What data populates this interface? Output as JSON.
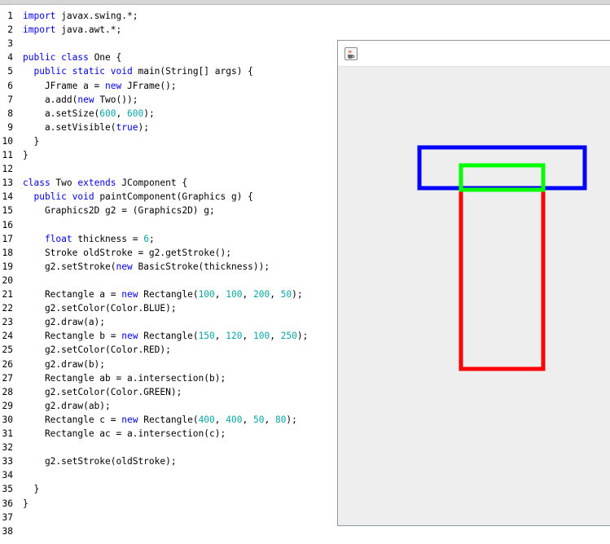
{
  "code_lines": [
    {
      "n": "1",
      "tokens": [
        {
          "t": "import",
          "c": "kw"
        },
        {
          "t": " javax.swing.*;"
        }
      ]
    },
    {
      "n": "2",
      "tokens": [
        {
          "t": "import",
          "c": "kw"
        },
        {
          "t": " java.awt.*;"
        }
      ]
    },
    {
      "n": "3",
      "tokens": []
    },
    {
      "n": "4",
      "tokens": [
        {
          "t": "public class",
          "c": "kw"
        },
        {
          "t": " One {"
        }
      ]
    },
    {
      "n": "5",
      "tokens": [
        {
          "t": "  "
        },
        {
          "t": "public static void",
          "c": "kw"
        },
        {
          "t": " main(String[] args) {"
        }
      ]
    },
    {
      "n": "6",
      "tokens": [
        {
          "t": "    JFrame a = "
        },
        {
          "t": "new",
          "c": "kw"
        },
        {
          "t": " JFrame();"
        }
      ]
    },
    {
      "n": "7",
      "tokens": [
        {
          "t": "    a.add("
        },
        {
          "t": "new",
          "c": "kw"
        },
        {
          "t": " Two());"
        }
      ]
    },
    {
      "n": "8",
      "tokens": [
        {
          "t": "    a.setSize("
        },
        {
          "t": "600",
          "c": "num"
        },
        {
          "t": ", "
        },
        {
          "t": "600",
          "c": "num"
        },
        {
          "t": ");"
        }
      ]
    },
    {
      "n": "9",
      "tokens": [
        {
          "t": "    a.setVisible("
        },
        {
          "t": "true",
          "c": "kw"
        },
        {
          "t": ");"
        }
      ]
    },
    {
      "n": "10",
      "tokens": [
        {
          "t": "  }"
        }
      ]
    },
    {
      "n": "11",
      "tokens": [
        {
          "t": "}"
        }
      ]
    },
    {
      "n": "12",
      "tokens": []
    },
    {
      "n": "13",
      "tokens": [
        {
          "t": "class",
          "c": "kw"
        },
        {
          "t": " Two "
        },
        {
          "t": "extends",
          "c": "kw"
        },
        {
          "t": " JComponent {"
        }
      ]
    },
    {
      "n": "14",
      "tokens": [
        {
          "t": "  "
        },
        {
          "t": "public void",
          "c": "kw"
        },
        {
          "t": " paintComponent(Graphics g) {"
        }
      ]
    },
    {
      "n": "15",
      "tokens": [
        {
          "t": "    Graphics2D g2 = (Graphics2D) g;"
        }
      ]
    },
    {
      "n": "16",
      "tokens": []
    },
    {
      "n": "17",
      "tokens": [
        {
          "t": "    "
        },
        {
          "t": "float",
          "c": "kw"
        },
        {
          "t": " thickness = "
        },
        {
          "t": "6",
          "c": "num"
        },
        {
          "t": ";"
        }
      ]
    },
    {
      "n": "18",
      "tokens": [
        {
          "t": "    Stroke oldStroke = g2.getStroke();"
        }
      ]
    },
    {
      "n": "19",
      "tokens": [
        {
          "t": "    g2.setStroke("
        },
        {
          "t": "new",
          "c": "kw"
        },
        {
          "t": " BasicStroke(thickness));"
        }
      ]
    },
    {
      "n": "20",
      "tokens": []
    },
    {
      "n": "21",
      "tokens": [
        {
          "t": "    Rectangle a = "
        },
        {
          "t": "new",
          "c": "kw"
        },
        {
          "t": " Rectangle("
        },
        {
          "t": "100",
          "c": "num"
        },
        {
          "t": ", "
        },
        {
          "t": "100",
          "c": "num"
        },
        {
          "t": ", "
        },
        {
          "t": "200",
          "c": "num"
        },
        {
          "t": ", "
        },
        {
          "t": "50",
          "c": "num"
        },
        {
          "t": ");"
        }
      ]
    },
    {
      "n": "22",
      "tokens": [
        {
          "t": "    g2.setColor(Color.BLUE);"
        }
      ]
    },
    {
      "n": "23",
      "tokens": [
        {
          "t": "    g2.draw(a);"
        }
      ]
    },
    {
      "n": "24",
      "tokens": [
        {
          "t": "    Rectangle b = "
        },
        {
          "t": "new",
          "c": "kw"
        },
        {
          "t": " Rectangle("
        },
        {
          "t": "150",
          "c": "num"
        },
        {
          "t": ", "
        },
        {
          "t": "120",
          "c": "num"
        },
        {
          "t": ", "
        },
        {
          "t": "100",
          "c": "num"
        },
        {
          "t": ", "
        },
        {
          "t": "250",
          "c": "num"
        },
        {
          "t": ");"
        }
      ]
    },
    {
      "n": "25",
      "tokens": [
        {
          "t": "    g2.setColor(Color.RED);"
        }
      ]
    },
    {
      "n": "26",
      "tokens": [
        {
          "t": "    g2.draw(b);"
        }
      ]
    },
    {
      "n": "27",
      "tokens": [
        {
          "t": "    Rectangle ab = a.intersection(b);"
        }
      ]
    },
    {
      "n": "28",
      "tokens": [
        {
          "t": "    g2.setColor(Color.GREEN);"
        }
      ]
    },
    {
      "n": "29",
      "tokens": [
        {
          "t": "    g2.draw(ab);"
        }
      ]
    },
    {
      "n": "30",
      "tokens": [
        {
          "t": "    Rectangle c = "
        },
        {
          "t": "new",
          "c": "kw"
        },
        {
          "t": " Rectangle("
        },
        {
          "t": "400",
          "c": "num"
        },
        {
          "t": ", "
        },
        {
          "t": "400",
          "c": "num"
        },
        {
          "t": ", "
        },
        {
          "t": "50",
          "c": "num"
        },
        {
          "t": ", "
        },
        {
          "t": "80",
          "c": "num"
        },
        {
          "t": ");"
        }
      ]
    },
    {
      "n": "31",
      "tokens": [
        {
          "t": "    Rectangle ac = a.intersection(c);"
        }
      ]
    },
    {
      "n": "32",
      "tokens": []
    },
    {
      "n": "33",
      "tokens": [
        {
          "t": "    g2.setStroke(oldStroke);"
        }
      ]
    },
    {
      "n": "34",
      "tokens": []
    },
    {
      "n": "35",
      "tokens": [
        {
          "t": "  }"
        }
      ]
    },
    {
      "n": "36",
      "tokens": [
        {
          "t": "}"
        }
      ]
    },
    {
      "n": "37",
      "tokens": []
    },
    {
      "n": "38",
      "tokens": []
    }
  ],
  "colors": {
    "keyword": "#0000e6",
    "number": "#0aa5a5",
    "blue_rect": "#0000ff",
    "red_rect": "#ff0000",
    "green_rect": "#00ff00"
  },
  "frame": {
    "icon": "java-coffee-icon"
  }
}
